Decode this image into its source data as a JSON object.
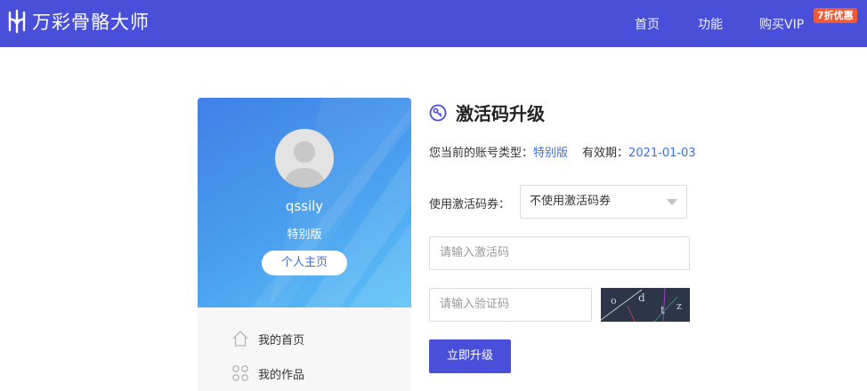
{
  "header": {
    "logo_text": "万彩骨骼大师",
    "nav": [
      {
        "label": "首页"
      },
      {
        "label": "功能"
      },
      {
        "label": "购买VIP"
      }
    ],
    "promo_badge": "7折优惠",
    "colors": {
      "bar": "#4a4fd9",
      "promo": "#f05b36"
    }
  },
  "profile": {
    "username": "qssily",
    "account_type": "特别版",
    "home_button": "个人主页"
  },
  "menu": {
    "items": [
      {
        "label": "我的首页",
        "icon": "home-icon"
      },
      {
        "label": "我的作品",
        "icon": "grid-icon"
      }
    ]
  },
  "upgrade": {
    "title": "激活码升级",
    "title_icon": "key-icon",
    "account_type_label": "您当前的账号类型：",
    "account_type_value": "特别版",
    "expiry_label": "有效期：",
    "expiry_value": "2021-01-03",
    "coupon_label": "使用激活码券：",
    "coupon_selected": "不使用激活码券",
    "code_placeholder": "请输入激活码",
    "captcha_placeholder": "请输入验证码",
    "captcha_text": "o d t z",
    "submit_label": "立即升级"
  }
}
